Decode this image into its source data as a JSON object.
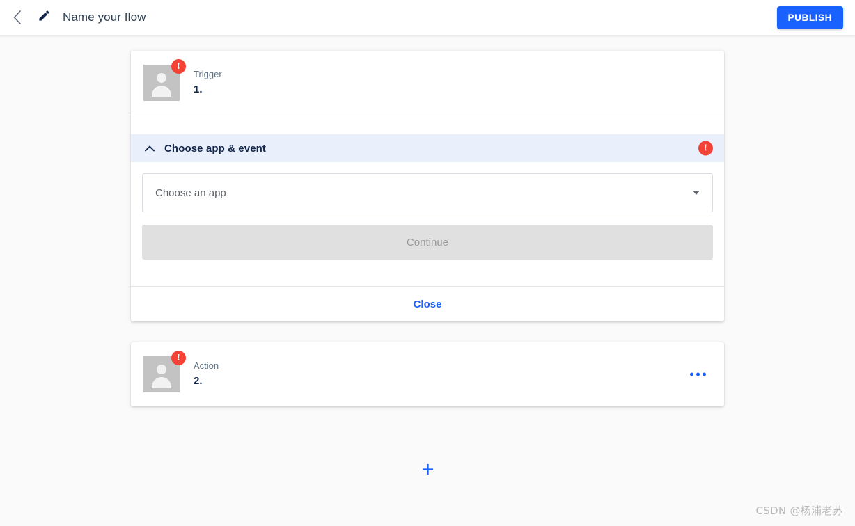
{
  "appbar": {
    "back_icon": "chevron-left-icon",
    "edit_icon": "pencil-icon",
    "title": "Name your flow",
    "publish_label": "PUBLISH",
    "publish_color": "#1a62ff"
  },
  "colors": {
    "background": "#fafafa",
    "accent_blue": "#1a62ff",
    "error_red": "#f44336",
    "accordion_header_bg": "#eaf0fb",
    "navy_text": "#12264b",
    "avatar_gray": "#c3c3c3"
  },
  "steps": [
    {
      "kind": "Trigger",
      "number": "1.",
      "badge": "!",
      "avatar_icon": "person-placeholder-icon",
      "accordion": {
        "title": "Choose app & event",
        "chevron": "chevron-up-icon",
        "badge": "!",
        "select_placeholder": "Choose an app",
        "caret_icon": "chevron-down-icon",
        "continue_label": "Continue",
        "close_label": "Close"
      }
    },
    {
      "kind": "Action",
      "number": "2.",
      "badge": "!",
      "avatar_icon": "person-placeholder-icon",
      "menu_icon": "more-horizontal-icon"
    }
  ],
  "connectors": [
    {
      "icon": "plus-icon",
      "label": "+"
    },
    {
      "icon": "plus-icon",
      "label": "+"
    }
  ],
  "watermark": "CSDN @杨浦老苏"
}
